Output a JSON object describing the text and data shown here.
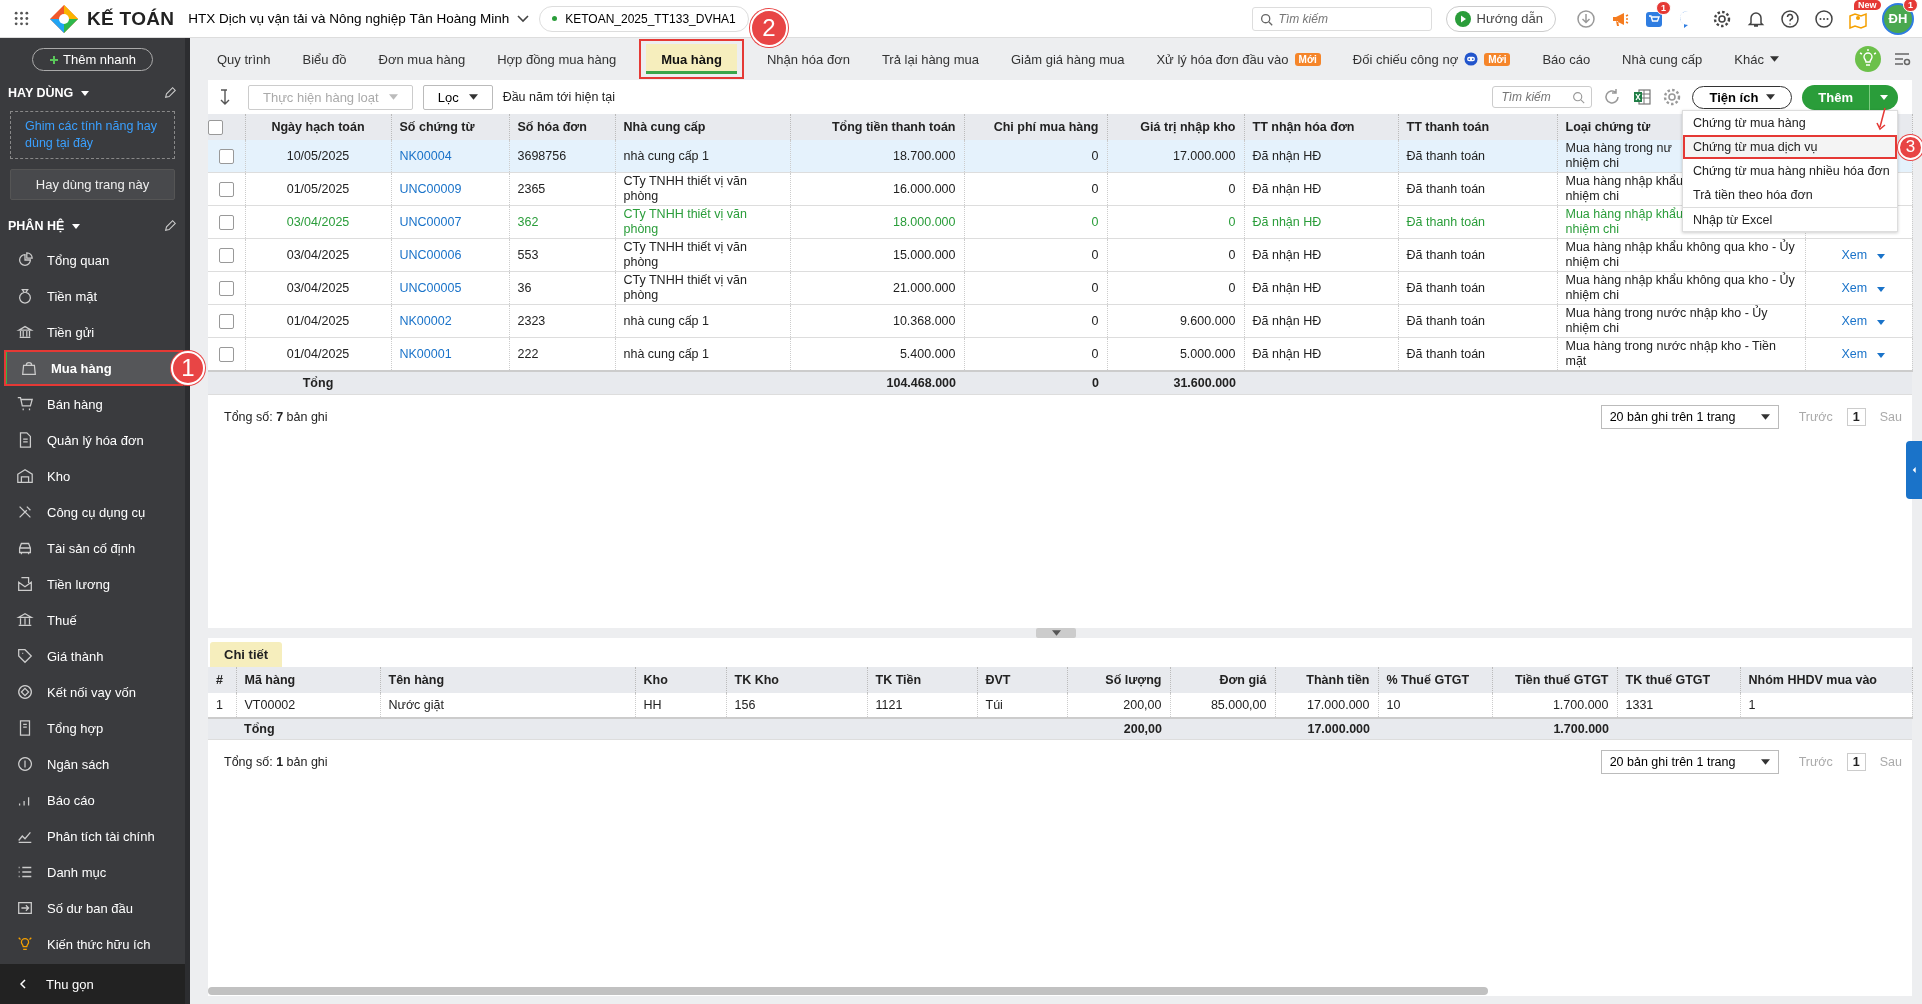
{
  "topbar": {
    "app_name": "KẾ TOÁN",
    "company": "HTX Dịch vụ vận tải và Nông nghiệp Tân Hoàng Minh",
    "database": "KETOAN_2025_TT133_DVHA1",
    "search_placeholder": "Tìm kiếm",
    "guide_button": "Hướng dẫn",
    "cart_badge": "1",
    "new_badge": "New",
    "avatar": "ĐH",
    "avatar_badge": "1"
  },
  "sidebar": {
    "quick_add": "Thêm nhanh",
    "favorites_title": "HAY DÙNG",
    "pin_hint": "Ghim các tính năng hay dùng tại đây",
    "favorite_page_button": "Hay dùng trang này",
    "modules_title": "PHÂN HỆ",
    "collapse": "Thu gọn",
    "items": [
      {
        "label": "Tổng quan",
        "selected": false
      },
      {
        "label": "Tiền mặt",
        "selected": false
      },
      {
        "label": "Tiền gửi",
        "selected": false
      },
      {
        "label": "Mua hàng",
        "selected": true,
        "callout": "1"
      },
      {
        "label": "Bán hàng",
        "selected": false
      },
      {
        "label": "Quản lý hóa đơn",
        "selected": false
      },
      {
        "label": "Kho",
        "selected": false
      },
      {
        "label": "Công cụ dụng cụ",
        "selected": false
      },
      {
        "label": "Tài sản cố định",
        "selected": false
      },
      {
        "label": "Tiền lương",
        "selected": false
      },
      {
        "label": "Thuế",
        "selected": false
      },
      {
        "label": "Giá thành",
        "selected": false
      },
      {
        "label": "Kết nối vay vốn",
        "selected": false
      },
      {
        "label": "Tổng hợp",
        "selected": false
      },
      {
        "label": "Ngân sách",
        "selected": false
      },
      {
        "label": "Báo cáo",
        "selected": false
      },
      {
        "label": "Phân tích tài chính",
        "selected": false
      },
      {
        "label": "Danh mục",
        "selected": false
      },
      {
        "label": "Số dư ban đầu",
        "selected": false
      },
      {
        "label": "Kiến thức hữu ích",
        "selected": false
      }
    ]
  },
  "tabs": [
    {
      "label": "Quy trình",
      "selected": false
    },
    {
      "label": "Biểu đồ",
      "selected": false
    },
    {
      "label": "Đơn mua hàng",
      "selected": false
    },
    {
      "label": "Hợp đồng mua hàng",
      "selected": false
    },
    {
      "label": "Mua hàng",
      "selected": true,
      "callout": "2"
    },
    {
      "label": "Nhận hóa đơn",
      "selected": false
    },
    {
      "label": "Trả lại hàng mua",
      "selected": false
    },
    {
      "label": "Giảm giá hàng mua",
      "selected": false
    },
    {
      "label": "Xử lý hóa đơn đầu vào",
      "selected": false,
      "badge": "Mới"
    },
    {
      "label": "Đối chiếu công nợ",
      "selected": false,
      "badge": "Mới",
      "robot": true
    },
    {
      "label": "Báo cáo",
      "selected": false
    },
    {
      "label": "Nhà cung cấp",
      "selected": false
    }
  ],
  "tabs_more": "Khác",
  "toolbar": {
    "bulk_action": "Thực hiện hàng loạt",
    "filter": "Lọc",
    "period": "Đầu năm tới hiện tại",
    "search_placeholder": "Tìm kiếm",
    "utilities": "Tiện ích",
    "add": "Thêm"
  },
  "add_menu": [
    {
      "label": "Chứng từ mua hàng",
      "selected": false,
      "separated": false
    },
    {
      "label": "Chứng từ mua dịch vụ",
      "selected": true,
      "separated": false,
      "callout": "3"
    },
    {
      "label": "Chứng từ mua hàng nhiều hóa đơn",
      "selected": false,
      "separated": false
    },
    {
      "label": "Trả tiền theo hóa đơn",
      "selected": false,
      "separated": false
    },
    {
      "label": "Nhập từ Excel",
      "selected": false,
      "separated": true
    }
  ],
  "table": {
    "checked": false,
    "columns": [
      "Ngày hạch toán",
      "Số chứng từ",
      "Số hóa đơn",
      "Nhà cung cấp",
      "Tổng tiền thanh toán",
      "Chi phí mua hàng",
      "Giá trị nhập kho",
      "TT nhận hóa đơn",
      "TT thanh toán",
      "Loại chứng từ"
    ],
    "rows": [
      {
        "date": "10/05/2025",
        "voucher": "NK00004",
        "invoice": "3698756",
        "supplier": "nhà cung cấp 1",
        "total": "18.700.000",
        "cost": "0",
        "stock_value": "17.000.000",
        "invoice_status": "Đã nhận HĐ",
        "payment_status": "Đã thanh toán",
        "doc_type": [
          "Mua hàng trong nư",
          "nhiệm chi"
        ],
        "checked": false,
        "selected": true,
        "kind": "normal"
      },
      {
        "date": "01/05/2025",
        "voucher": "UNC00009",
        "invoice": "2365",
        "supplier": "CTy TNHH thiết vị văn phòng",
        "total": "16.000.000",
        "cost": "0",
        "stock_value": "0",
        "invoice_status": "Đã nhận HĐ",
        "payment_status": "Đã thanh toán",
        "doc_type": [
          "Mua hàng nhập khẩu",
          "nhiệm chi"
        ],
        "checked": false,
        "selected": false,
        "kind": "normal"
      },
      {
        "date": "03/04/2025",
        "voucher": "UNC00007",
        "invoice": "362",
        "supplier": "CTy TNHH thiết vị văn phòng",
        "total": "18.000.000",
        "cost": "0",
        "stock_value": "0",
        "invoice_status": "Đã nhận HĐ",
        "payment_status": "Đã thanh toán",
        "doc_type": [
          "Mua hàng nhập khẩu",
          "nhiệm chi"
        ],
        "checked": false,
        "selected": false,
        "kind": "highlight"
      },
      {
        "date": "03/04/2025",
        "voucher": "UNC00006",
        "invoice": "553",
        "supplier": "CTy TNHH thiết vị văn phòng",
        "total": "15.000.000",
        "cost": "0",
        "stock_value": "0",
        "invoice_status": "Đã nhận HĐ",
        "payment_status": "Đã thanh toán",
        "doc_type": [
          "Mua hàng nhập khẩu không qua kho - Ủy",
          "nhiệm chi"
        ],
        "action": "Xem",
        "checked": false,
        "selected": false,
        "kind": "normal"
      },
      {
        "date": "03/04/2025",
        "voucher": "UNC00005",
        "invoice": "36",
        "supplier": "CTy TNHH thiết vị văn phòng",
        "total": "21.000.000",
        "cost": "0",
        "stock_value": "0",
        "invoice_status": "Đã nhận HĐ",
        "payment_status": "Đã thanh toán",
        "doc_type": [
          "Mua hàng nhập khẩu không qua kho - Ủy",
          "nhiệm chi"
        ],
        "action": "Xem",
        "checked": false,
        "selected": false,
        "kind": "normal"
      },
      {
        "date": "01/04/2025",
        "voucher": "NK00002",
        "invoice": "2323",
        "supplier": "nhà cung cấp 1",
        "total": "10.368.000",
        "cost": "0",
        "stock_value": "9.600.000",
        "invoice_status": "Đã nhận HĐ",
        "payment_status": "Đã thanh toán",
        "doc_type": [
          "Mua hàng trong nước nhập kho - Ủy",
          "nhiệm chi"
        ],
        "action": "Xem",
        "checked": false,
        "selected": false,
        "kind": "normal"
      },
      {
        "date": "01/04/2025",
        "voucher": "NK00001",
        "invoice": "222",
        "supplier": "nhà cung cấp 1",
        "total": "5.400.000",
        "cost": "0",
        "stock_value": "5.000.000",
        "invoice_status": "Đã nhận HĐ",
        "payment_status": "Đã thanh toán",
        "doc_type": [
          "Mua hàng trong nước nhập kho - Tiền",
          "mặt"
        ],
        "action": "Xem",
        "checked": false,
        "selected": false,
        "kind": "normal"
      }
    ],
    "total": {
      "label": "Tổng",
      "total": "104.468.000",
      "cost": "0",
      "stock_value": "31.600.000"
    },
    "summary": "Tổng số: **7** bản ghi",
    "pagination": {
      "page_size": "20 bản ghi trên 1 trang",
      "prev": "Trước",
      "page": "1",
      "next": "Sau"
    }
  },
  "detail": {
    "tab": "Chi tiết",
    "columns": [
      "#",
      "Mã hàng",
      "Tên hàng",
      "Kho",
      "TK Kho",
      "TK Tiền",
      "ĐVT",
      "Số lượng",
      "Đơn giá",
      "Thành tiền",
      "% Thuế GTGT",
      "Tiền thuế GTGT",
      "TK thuế GTGT",
      "Nhóm HHDV mua vào"
    ],
    "rows": [
      [
        "1",
        "VT00002",
        "Nước giặt",
        "HH",
        "156",
        "1121",
        "Túi",
        "200,00",
        "85.000,00",
        "17.000.000",
        "10",
        "1.700.000",
        "1331",
        "1"
      ]
    ],
    "total": {
      "label": "Tổng",
      "quantity": "200,00",
      "amount": "17.000.000",
      "tax_amount": "1.700.000"
    },
    "summary": "Tổng số: **1** bản ghi",
    "pagination": {
      "page_size": "20 bản ghi trên 1 trang",
      "prev": "Trước",
      "page": "1",
      "next": "Sau"
    }
  }
}
